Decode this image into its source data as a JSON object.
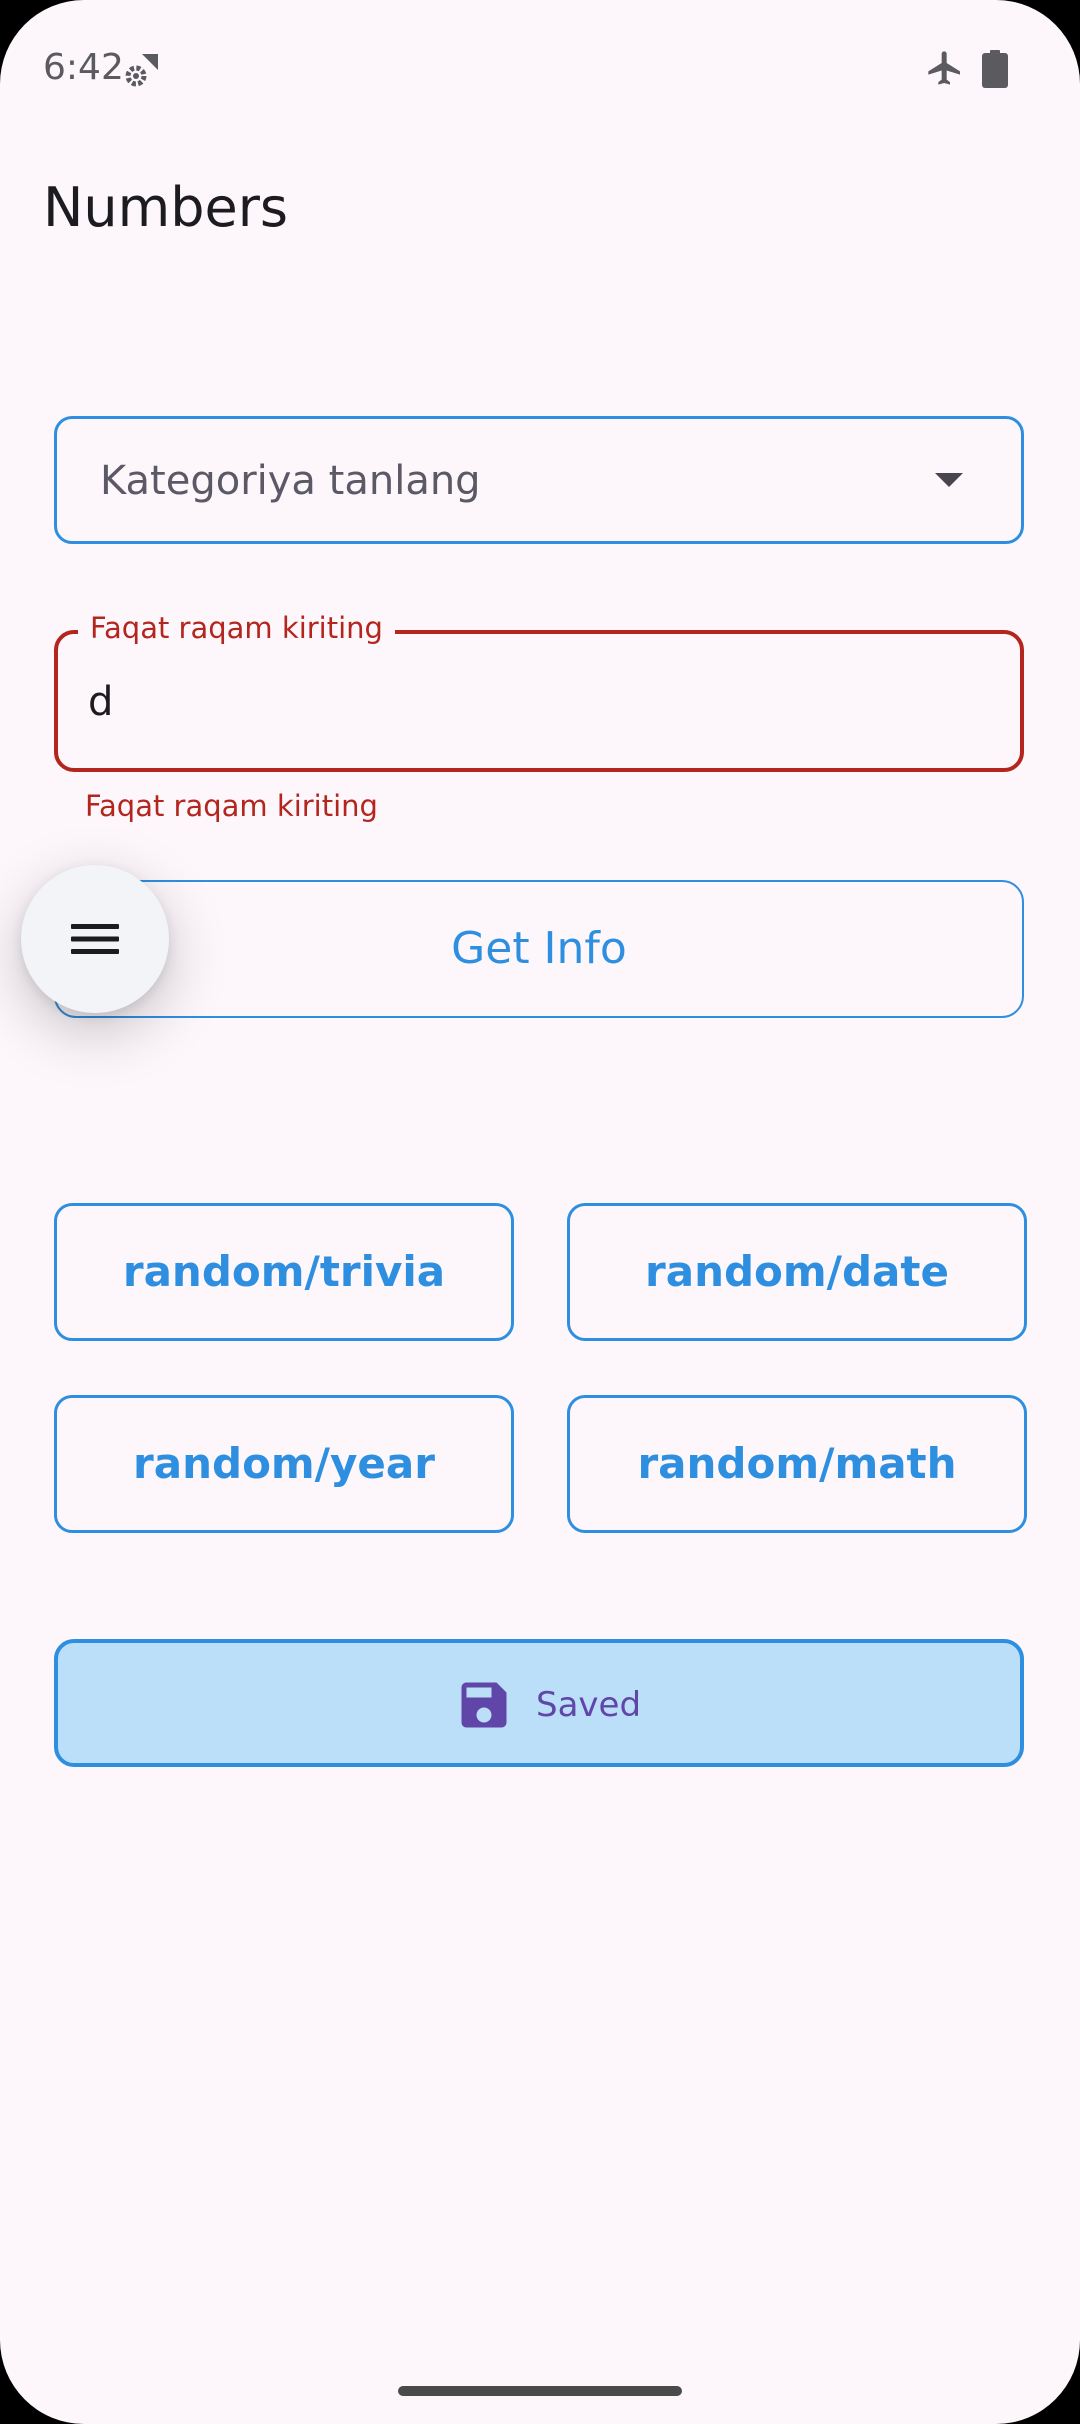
{
  "status_bar": {
    "time": "6:42",
    "icons": [
      "settings-sync-icon",
      "airplane-mode-icon",
      "battery-icon"
    ]
  },
  "app_bar": {
    "title": "Numbers"
  },
  "category_dropdown": {
    "selected_label": "Kategoriya tanlang"
  },
  "number_field": {
    "label": "Faqat raqam kiriting",
    "value": "d",
    "error": "Faqat raqam kiriting"
  },
  "get_info_button": {
    "label": "Get Info"
  },
  "menu_button": {
    "icon": "menu-icon"
  },
  "random_buttons": [
    {
      "label": "random/trivia"
    },
    {
      "label": "random/date"
    },
    {
      "label": "random/year"
    },
    {
      "label": "random/math"
    }
  ],
  "saved_button": {
    "label": "Saved",
    "icon": "save-icon"
  },
  "colors": {
    "background": "#FDF7FC",
    "accent": "#2E8FE0",
    "error": "#B3261E",
    "saved_fill": "#BCDFF9",
    "saved_text": "#5F46A8"
  }
}
